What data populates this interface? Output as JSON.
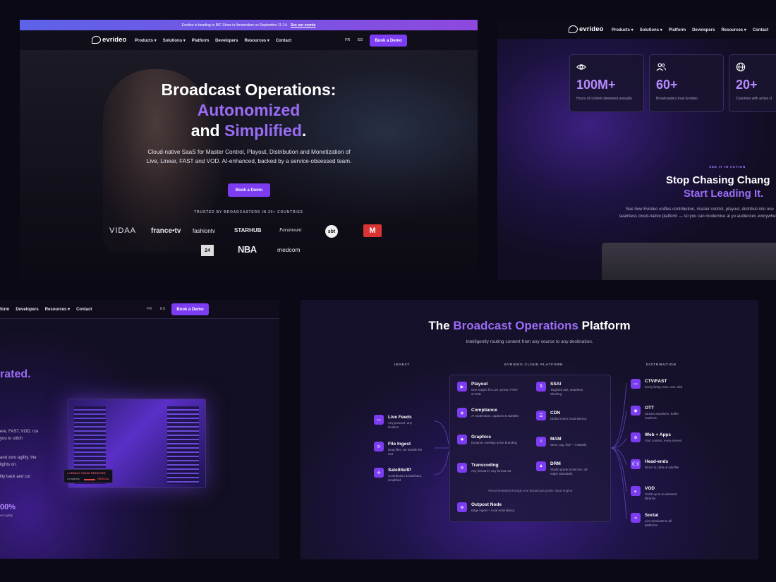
{
  "nav": {
    "brand": "evrideo",
    "products": "Products",
    "solutions": "Solutions",
    "platform": "Platform",
    "developers": "Developers",
    "resources": "Resources",
    "contact": "Contact",
    "lang_fr": "FR",
    "lang_es": "ES",
    "demo": "Book a Demo"
  },
  "banner": {
    "text": "Evrideo is heading to IBC Show in Amsterdam on September 11-14.",
    "link": "See our events"
  },
  "hero": {
    "line1": "Broadcast Operations:",
    "line2": "Autonomized",
    "line3a": "and ",
    "line3b": "Simplified",
    "line3c": ".",
    "sub": "Cloud-native SaaS for Master Control, Playout, Distribution and Monetization of Live, Linear, FAST and VOD. AI-enhanced, backed by a service-obsessed team.",
    "cta": "Book a Demo",
    "trusted": "TRUSTED BY BROADCASTERS IN 20+ COUNTRIES",
    "logos": [
      "VIDAA",
      "france•tv",
      "fashiontv",
      "STARHUB",
      "Paramount",
      "sbt",
      "M",
      "24",
      "NBA",
      "medcom"
    ]
  },
  "stats": [
    {
      "value": "100M+",
      "caption": "Hours of content streamed annually",
      "icon": "eye-icon"
    },
    {
      "value": "60+",
      "caption": "Broadcasters trust Evrideo",
      "icon": "users-icon"
    },
    {
      "value": "20+",
      "caption": "Countries with active cl",
      "icon": "globe-icon"
    }
  ],
  "action": {
    "kicker": "SEE IT IN ACTION",
    "title1": "Stop Chasing Chang",
    "title2": "Start Leading It.",
    "sub": "See how Evrideo unifies contribution, master control, playout, distributi into one seamless cloud-native platform — so you can modernise at yo audiences everywhere."
  },
  "panelC": {
    "nav_partial": "form",
    "heading_tail": "rated.",
    "p1": "ere, FAST, VOD, rce you to stitch",
    "p2": "and zero agility. the lights on.",
    "p3": "lity back and cut",
    "legacy": "LEGACY STACK DETECTED",
    "complexity": "Complexity",
    "critical": "CRITICAL",
    "stat_value": "00%",
    "stat_caption": "ed Agility"
  },
  "platform": {
    "title_a": "The ",
    "title_b": "Broadcast Operations",
    "title_c": " Platform",
    "sub": "Intelligently routing content from any source to any destination.",
    "col_ingest": "INGEST",
    "col_cloud": "EVRIDEO CLOUD PLATFORM",
    "col_dist": "DISTRIBUTION",
    "ingest": [
      {
        "t": "Live Feeds",
        "d": "Any protocol, any location"
      },
      {
        "t": "File Ingest",
        "d": "Drop files, we handle the rest"
      },
      {
        "t": "Satellite/IP",
        "d": "Contribution & backhaul, simplified"
      }
    ],
    "cloud": [
      {
        "t": "Playout",
        "d": "One engine for Live, Linear, FAST & VOD"
      },
      {
        "t": "SSAI",
        "d": "Targeted ads, seamless stitching"
      },
      {
        "t": "Compliance",
        "d": "AI moderation, captions & subtitles"
      },
      {
        "t": "CDN",
        "d": "Global reach, local latency"
      },
      {
        "t": "Graphics",
        "d": "Dynamic overlays & live branding"
      },
      {
        "t": "MAM",
        "d": "Store, tag, find — instantly"
      },
      {
        "t": "Transcoding",
        "d": "Any format in, any format out"
      },
      {
        "t": "DRM",
        "d": "Studio-grade protection, all major standards"
      }
    ],
    "orchestrated": "All orchestrated through one broadcast-grade cloud engine",
    "edge": {
      "t": "Outpost Node",
      "d": "Edge ingest + local redundancy"
    },
    "dist": [
      {
        "t": "CTV/FAST",
        "d": "Every living room, one click"
      },
      {
        "t": "OTT",
        "d": "Stream anywhere, buffer nowhere"
      },
      {
        "t": "Web + Apps",
        "d": "Your content, every screen"
      },
      {
        "t": "Head-ends",
        "d": "Direct to cable & satellite"
      },
      {
        "t": "VOD",
        "d": "Catch-up & on-demand libraries"
      },
      {
        "t": "Social",
        "d": "Live simulcast to all platforms"
      }
    ]
  }
}
